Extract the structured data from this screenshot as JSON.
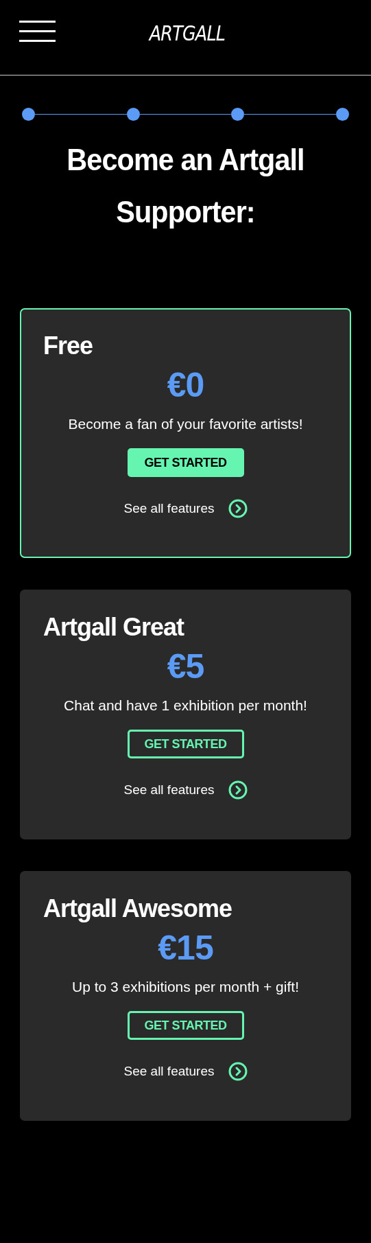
{
  "header": {
    "logo": "ARTGALL"
  },
  "stepper": {
    "steps": [
      {
        "done": true
      },
      {
        "done": true
      },
      {
        "done": true
      },
      {
        "done": true
      }
    ]
  },
  "title": "Become an Artgall Supporter:",
  "plans": [
    {
      "name": "Free",
      "price": "€0",
      "description": "Become a fan of your favorite artists!",
      "button": "GET STARTED",
      "link": "See all features",
      "selected": true
    },
    {
      "name": "Artgall Great",
      "price": "€5",
      "description": "Chat and have 1 exhibition per month!",
      "button": "GET STARTED",
      "link": "See all features",
      "selected": false
    },
    {
      "name": "Artgall Awesome",
      "price": "€15",
      "description": "Up to 3 exhibitions per month + gift!",
      "button": "GET STARTED",
      "link": "See all features",
      "selected": false
    }
  ]
}
